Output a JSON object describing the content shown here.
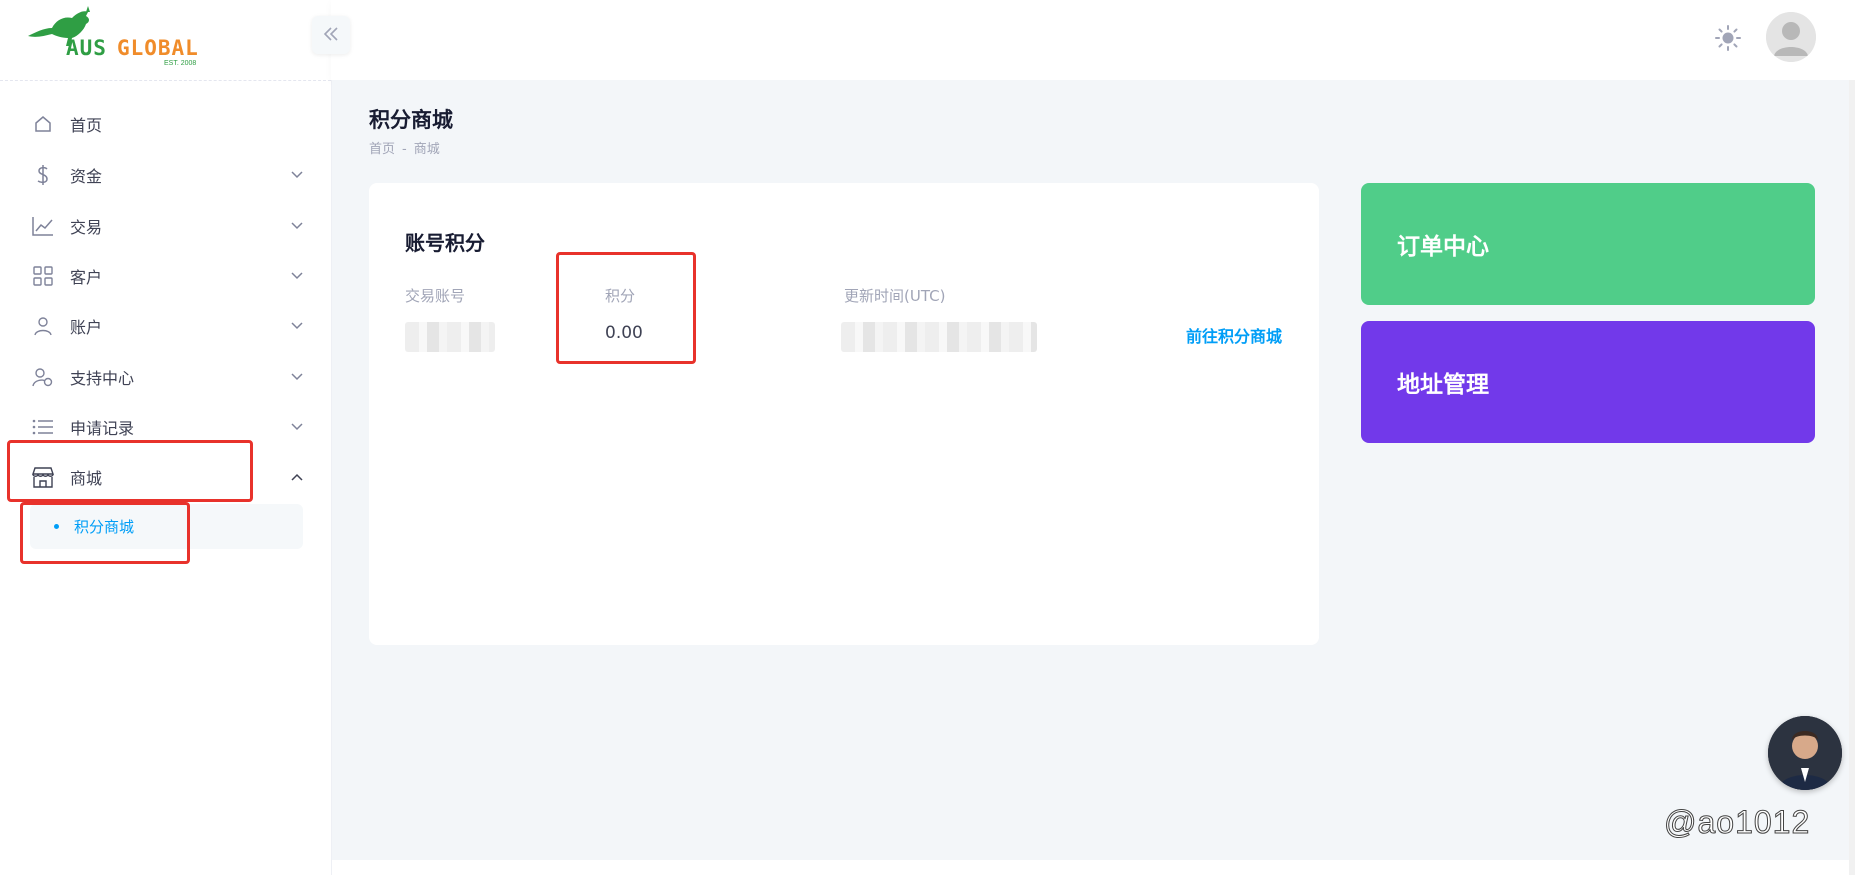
{
  "brand": {
    "name_part1": "AUS",
    "name_part2": "GLOBAL",
    "est": "EST. 2008"
  },
  "sidebar": {
    "items": [
      {
        "label": "首页",
        "icon": "home-icon"
      },
      {
        "label": "资金",
        "icon": "dollar-icon"
      },
      {
        "label": "交易",
        "icon": "chart-line-icon"
      },
      {
        "label": "客户",
        "icon": "grid-icon"
      },
      {
        "label": "账户",
        "icon": "user-icon"
      },
      {
        "label": "支持中心",
        "icon": "user-settings-icon"
      },
      {
        "label": "申请记录",
        "icon": "list-icon"
      },
      {
        "label": "商城",
        "icon": "store-icon",
        "expanded": true
      }
    ],
    "subitems": [
      {
        "label": "积分商城",
        "active": true
      }
    ]
  },
  "page": {
    "title": "积分商城",
    "breadcrumb": [
      "首页",
      "商城"
    ],
    "breadcrumb_sep": "-"
  },
  "points_card": {
    "title": "账号积分",
    "columns": {
      "account": "交易账号",
      "points": "积分",
      "updated": "更新时间(UTC)"
    },
    "values": {
      "points": "0.00"
    },
    "link": "前往积分商城"
  },
  "tiles": [
    {
      "label": "订单中心",
      "color": "#50cd89"
    },
    {
      "label": "地址管理",
      "color": "#7239ea"
    }
  ],
  "watermark": "@ao1012",
  "colors": {
    "accent": "#009ef7",
    "highlight_box": "#e8322b",
    "main_bg": "#f3f6f9"
  }
}
